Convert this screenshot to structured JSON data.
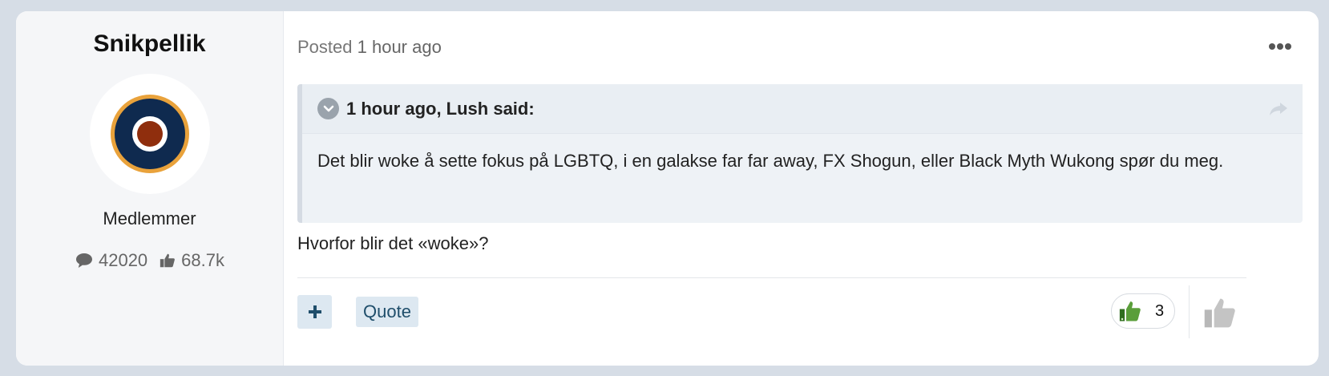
{
  "author": {
    "name": "Snikpellik",
    "avatar": "raf-roundel-avatar",
    "group": "Medlemmer",
    "stats": {
      "posts": "42020",
      "reputation": "68.7k"
    }
  },
  "post": {
    "posted_label": "Posted",
    "posted_time": "1 hour ago",
    "quote": {
      "citation": "1 hour ago, Lush said:",
      "body": "Det blir woke å sette fokus på LGBTQ, i en galakse far far away, FX Shogun, eller Black Myth Wukong spør du meg."
    },
    "body": "Hvorfor blir det «woke»?"
  },
  "actions": {
    "quote_label": "Quote",
    "reaction_count": "3"
  },
  "icons": [
    "more-icon",
    "chevron-down-icon",
    "share-icon",
    "plus-icon",
    "thumbs-up-icon",
    "comment-icon"
  ],
  "colors": {
    "accent": "#1f4e6b",
    "reaction_green": "#5a9e3a",
    "button_bg": "#dde8f1"
  }
}
